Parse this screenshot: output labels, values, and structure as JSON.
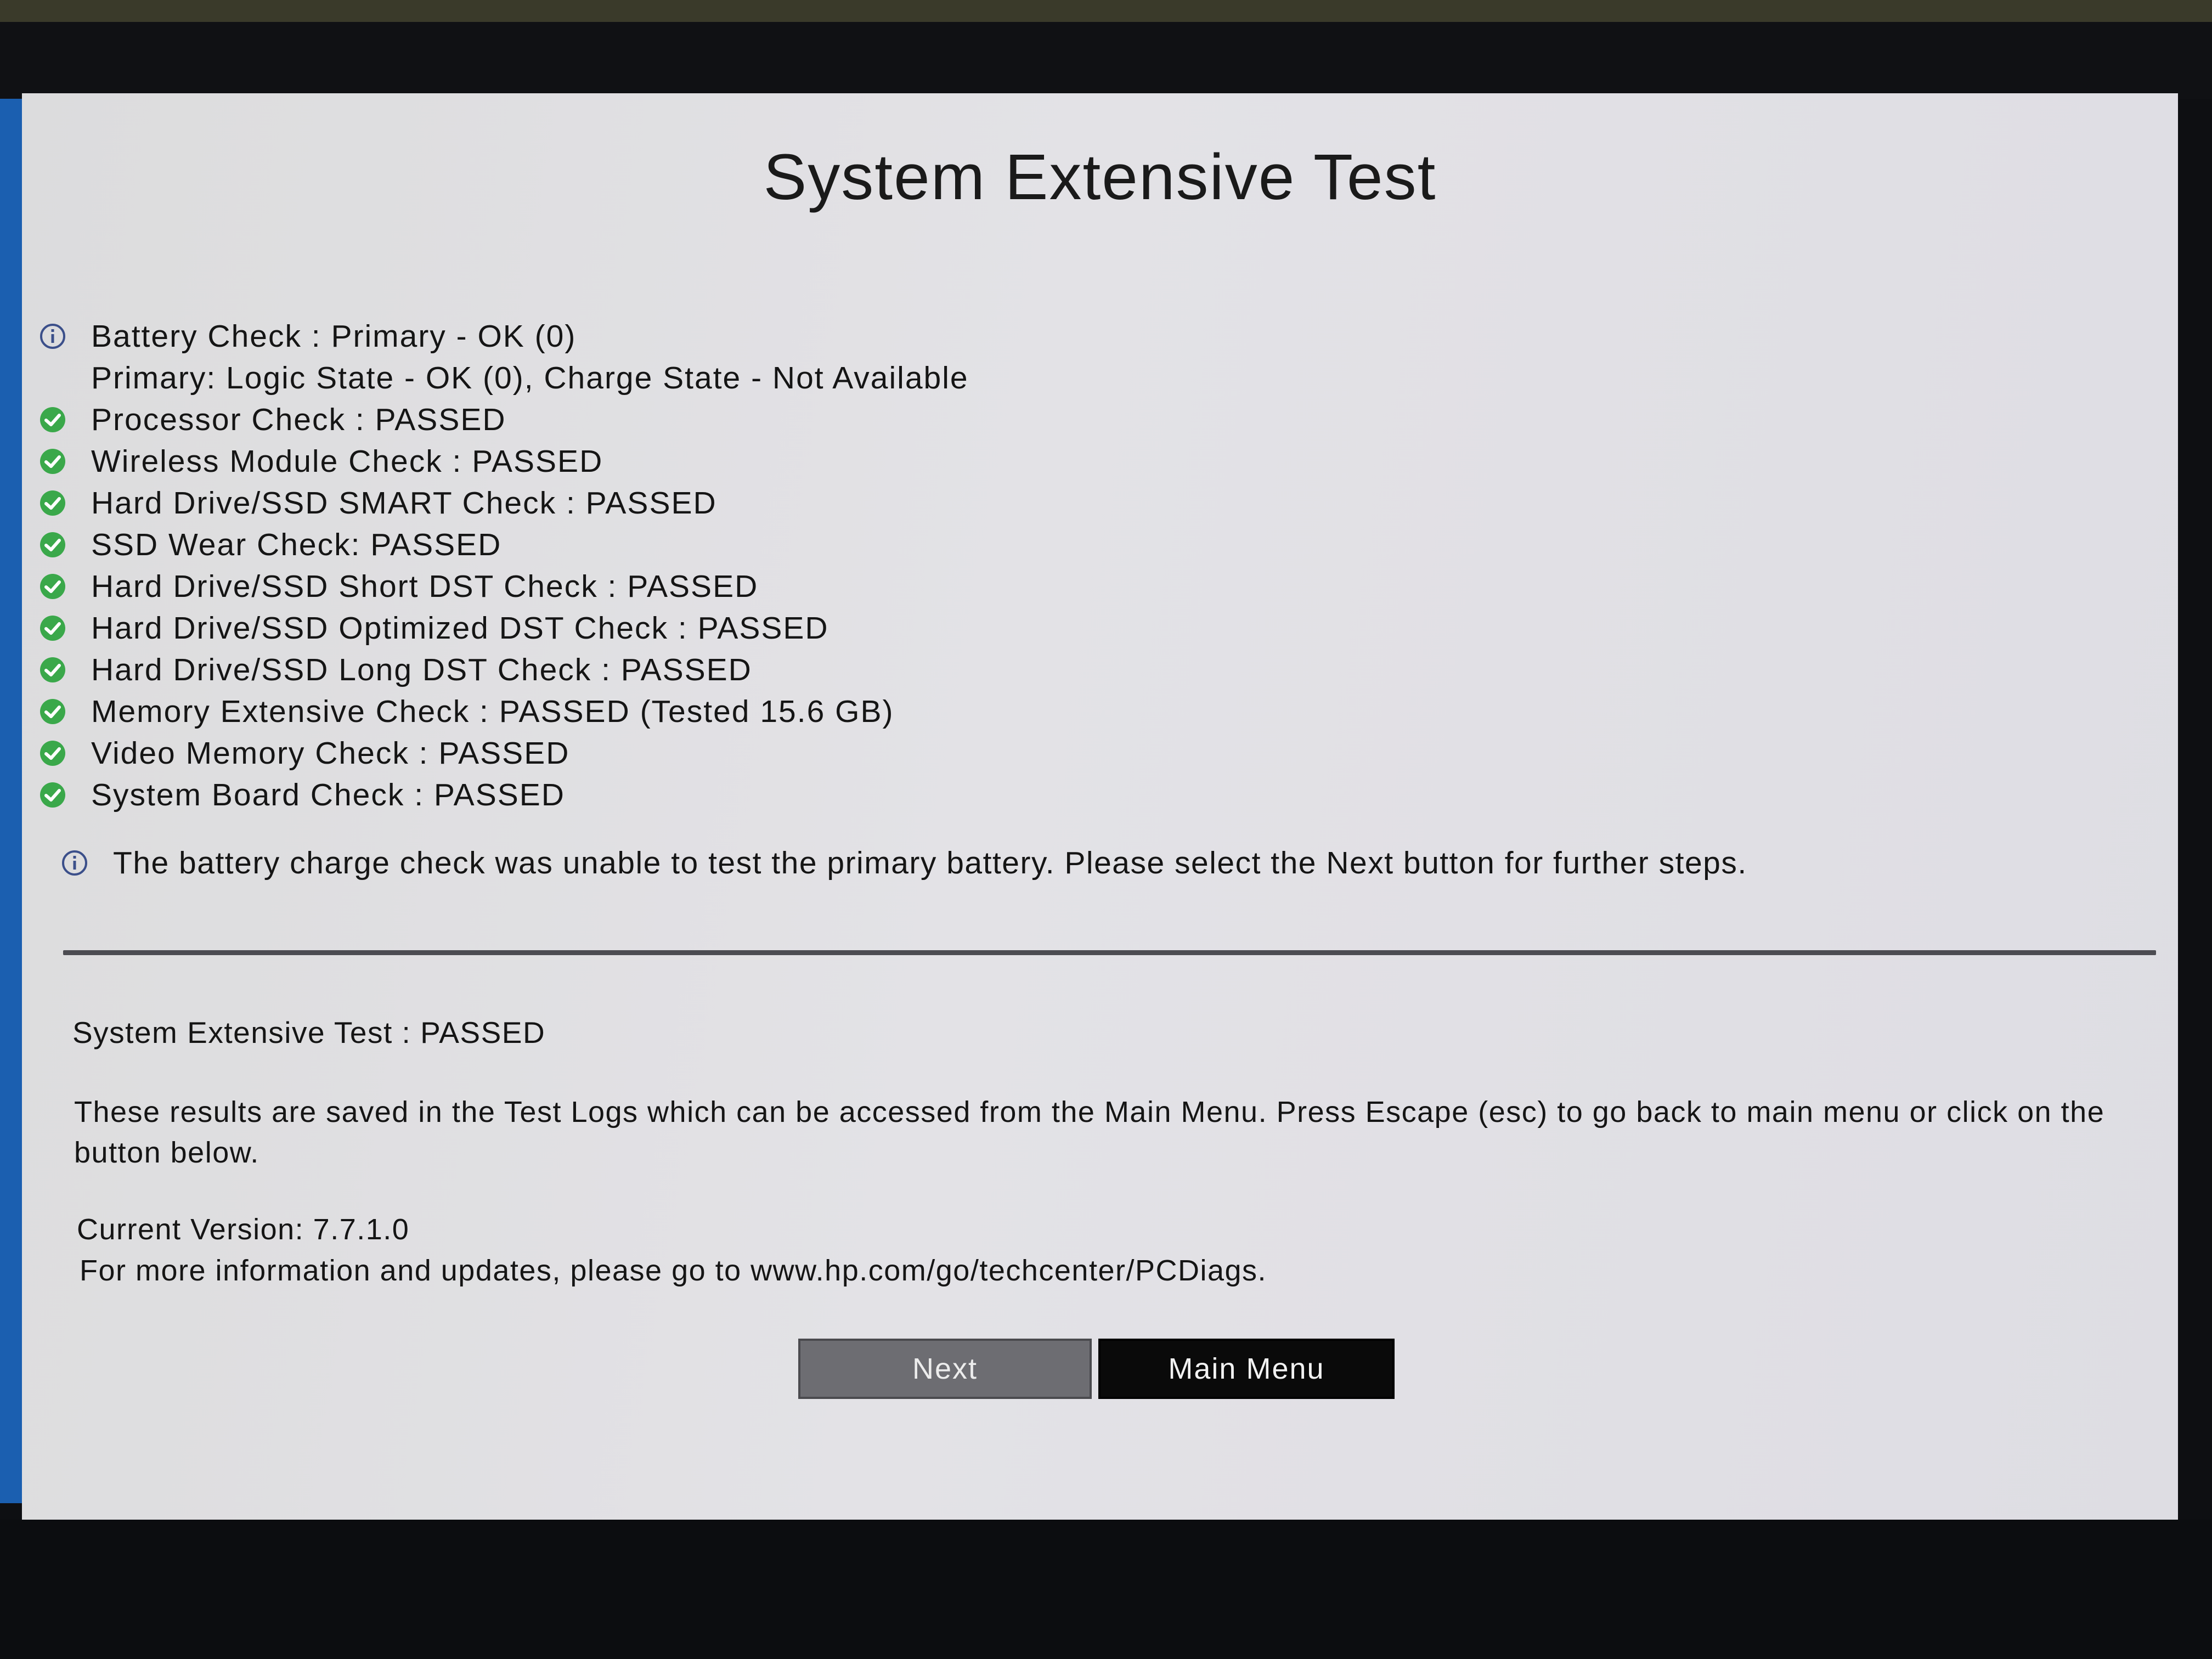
{
  "window": {
    "title": "System Extensive Test"
  },
  "results": [
    {
      "icon": "info",
      "text": "Battery Check : Primary - OK (0)"
    },
    {
      "icon": "none",
      "text": "Primary: Logic State - OK (0), Charge State - Not Available"
    },
    {
      "icon": "pass",
      "text": "Processor Check : PASSED"
    },
    {
      "icon": "pass",
      "text": "Wireless Module Check : PASSED"
    },
    {
      "icon": "pass",
      "text": "Hard Drive/SSD SMART Check : PASSED"
    },
    {
      "icon": "pass",
      "text": "SSD Wear Check: PASSED"
    },
    {
      "icon": "pass",
      "text": "Hard Drive/SSD Short DST Check : PASSED"
    },
    {
      "icon": "pass",
      "text": "Hard Drive/SSD Optimized DST Check : PASSED"
    },
    {
      "icon": "pass",
      "text": "Hard Drive/SSD Long DST Check : PASSED"
    },
    {
      "icon": "pass",
      "text": "Memory Extensive Check : PASSED (Tested 15.6 GB)"
    },
    {
      "icon": "pass",
      "text": "Video Memory Check : PASSED"
    },
    {
      "icon": "pass",
      "text": "System Board Check : PASSED"
    }
  ],
  "note": {
    "icon": "info",
    "text": "The battery charge check was unable to test the primary battery. Please select the Next button for further steps."
  },
  "summary": {
    "status": "System Extensive Test : PASSED",
    "info": "These results are saved in the Test Logs which can be accessed from the Main Menu. Press Escape (esc) to go back to main menu or click on the button below.",
    "version": "Current Version: 7.7.1.0",
    "more_info": "For more information and updates, please go to www.hp.com/go/techcenter/PCDiags."
  },
  "buttons": {
    "next": "Next",
    "main_menu": "Main Menu"
  },
  "colors": {
    "pass_green": "#3aa84a",
    "info_blue": "#3b4f8a",
    "next_bg": "#6d6d72",
    "main_menu_bg": "#0a0a0a"
  }
}
